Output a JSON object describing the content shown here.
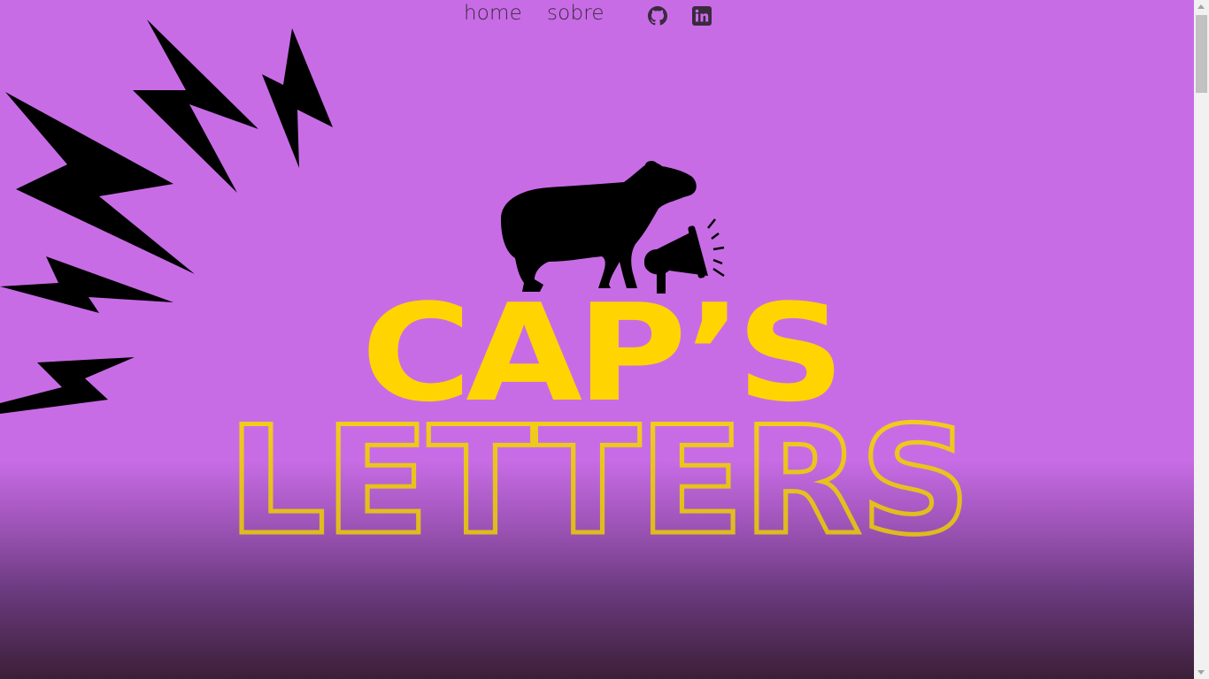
{
  "nav": {
    "home_label": "home",
    "sobre_label": "sobre",
    "github_icon": "github-icon",
    "linkedin_icon": "linkedin-icon"
  },
  "hero": {
    "title_line1": "CAP’S",
    "title_line2": "LETTERS",
    "mascot": "capybara-with-megaphone",
    "decoration": "lightning-bolts"
  },
  "colors": {
    "background": "#c86ce6",
    "gradient_bottom": "#3b1f37",
    "title_yellow": "#ffd400",
    "outline_yellow": "#f2cc1c",
    "nav_text": "#3a2a3e",
    "ink": "#000000"
  }
}
